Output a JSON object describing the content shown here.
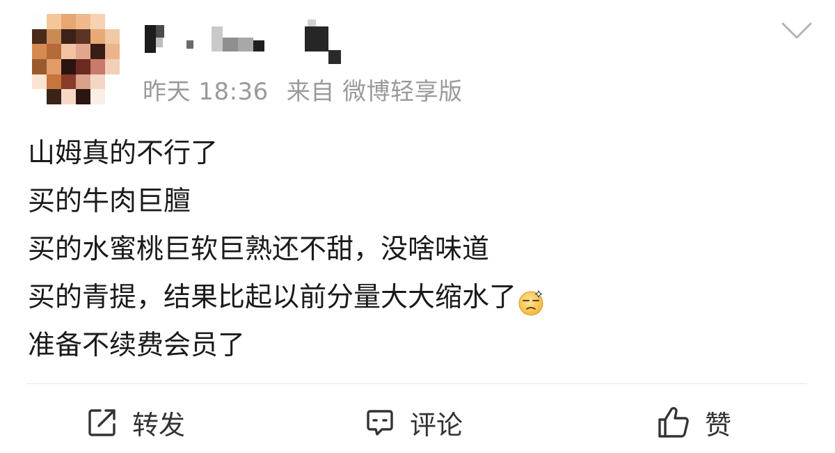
{
  "post": {
    "meta": {
      "time": "昨天 18:36",
      "source": "来自 微博轻享版"
    },
    "lines": [
      "山姆真的不行了",
      "买的牛肉巨膻",
      "买的水蜜桃巨软巨熟还不甜，没啥味道",
      "买的青提，结果比起以前分量大大缩水了",
      "准备不续费会员了"
    ],
    "emoji": "dizzy-face-emoji",
    "actions": {
      "repost": "转发",
      "comment": "评论",
      "like": "赞"
    }
  },
  "colors": {
    "text": "#1a1a1a",
    "meta": "#9a9a9a",
    "action_text": "#333333",
    "icon": "#333333",
    "divider": "#e6e6e6"
  }
}
